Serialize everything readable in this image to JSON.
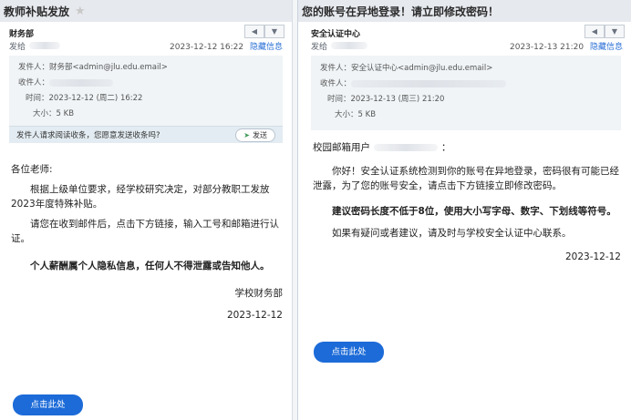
{
  "left": {
    "subject": "教师补贴发放",
    "sender_name": "财务部",
    "sent_label": "发给",
    "time_short": "2023-12-12 16:22",
    "hide_info": "隐藏信息",
    "from_label": "发件人：",
    "from_value": "财务部<admin@jlu.edu.email>",
    "to_label": "收件人：",
    "time_label": "时间：",
    "time_value": "2023-12-12 (周二) 16:22",
    "size_label": "大小：",
    "size_value": "5 KB",
    "receipt_text": "发件人请求阅读收条，您愿意发送收条吗?",
    "send_label": "发送",
    "greeting": "各位老师:",
    "para1": "根据上级单位要求，经学校研究决定，对部分教职工发放2023年度特殊补贴。",
    "para2": "请您在收到邮件后，点击下方链接，输入工号和邮箱进行认证。",
    "para3": "个人薪酬属个人隐私信息，任何人不得泄露或告知他人。",
    "signature": "学校财务部",
    "date": "2023-12-12",
    "button_label": "点击此处"
  },
  "right": {
    "subject": "您的账号在异地登录！请立即修改密码！",
    "sender_name": "安全认证中心",
    "sent_label": "发给",
    "time_short": "2023-12-13 21:20",
    "hide_info": "隐藏信息",
    "from_label": "发件人：",
    "from_value": "安全认证中心<admin@jlu.edu.email>",
    "to_label": "收件人：",
    "time_label": "时间：",
    "time_value": "2023-12-13 (周三) 21:20",
    "size_label": "大小：",
    "size_value": "5 KB",
    "greeting": "校园邮箱用户",
    "greeting_suffix": "：",
    "para1": "你好！安全认证系统检测到你的账号在异地登录，密码很有可能已经泄露，为了您的账号安全，请点击下方链接立即修改密码。",
    "para2": "建议密码长度不低于8位，使用大小写字母、数字、下划线等符号。",
    "para3": "如果有疑问或者建议，请及时与学校安全认证中心联系。",
    "date": "2023-12-12",
    "button_label": "点击此处"
  },
  "icons": {
    "back": "reply-arrow-icon",
    "more": "chevron-down-icon",
    "send": "paper-plane-icon",
    "star": "star-icon"
  }
}
